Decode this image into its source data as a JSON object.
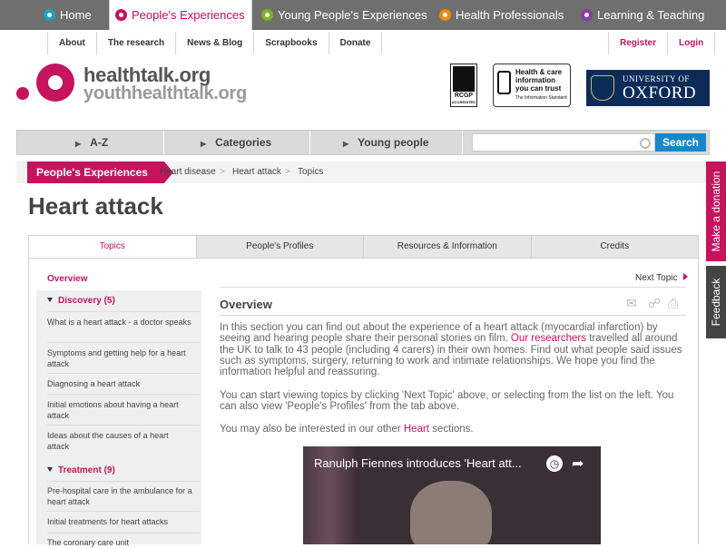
{
  "topnav": {
    "tabs": [
      {
        "label": "Home",
        "color": "#1aa3c4"
      },
      {
        "label": "People's Experiences",
        "color": "#c4145e"
      },
      {
        "label": "Young People's Experiences",
        "color": "#7ab51d"
      },
      {
        "label": "Health Professionals",
        "color": "#f08a00"
      },
      {
        "label": "Learning & Teaching",
        "color": "#8b3fa0"
      }
    ]
  },
  "subnav": {
    "left": [
      "About",
      "The research",
      "News & Blog",
      "Scrapbooks",
      "Donate"
    ],
    "right": [
      "Register",
      "Login"
    ]
  },
  "logo": {
    "line1": "healthtalk.org",
    "line2": "youthhealthtalk.org"
  },
  "badges": {
    "rcgp": "RCGP",
    "rcgp_sub": "ACCREDITED",
    "infostd": "Health & care information you can trust",
    "infostd_sub": "The Information Standard",
    "oxford_l1": "UNIVERSITY OF",
    "oxford_l2": "OXFORD"
  },
  "searchbar": {
    "items": [
      "A-Z",
      "Categories",
      "Young people"
    ],
    "search_button": "Search",
    "placeholder": ""
  },
  "breadcrumb": {
    "active": "People's Experiences",
    "items": [
      "Heart disease",
      "Heart attack",
      "Topics"
    ]
  },
  "page_title": "Heart attack",
  "side_tabs": {
    "donate": "Make a donation",
    "feedback": "Feedback"
  },
  "content_tabs": [
    "Topics",
    "People's Profiles",
    "Resources & Information",
    "Credits"
  ],
  "sidebar": {
    "overview": "Overview",
    "section1": "Discovery (5)",
    "section1_items": [
      "What is a heart attack - a doctor speaks",
      "Symptoms and getting help for a heart attack",
      "Diagnosing a heart attack",
      "Initial emotions about having a heart attack",
      "Ideas about the causes of a heart attack"
    ],
    "section2": "Treatment (9)",
    "section2_items": [
      "Pre-hospital care in the ambulance for a heart attack",
      "Initial treatments for heart attacks",
      "The coronary care unit"
    ]
  },
  "main": {
    "next_topic": "Next Topic",
    "heading": "Overview",
    "p1_a": "In this section you can find out about the experience of a heart attack (myocardial infarction) by seeing and hearing people share their personal stories on film. ",
    "p1_link": "Our researchers",
    "p1_b": " travelled all around the UK to talk to 43 people (including 4 carers) in their own homes. Find out what people said issues such as symptoms, surgery, returning to work and intimate relationships. We hope you find the information helpful and reassuring.",
    "p2": "You can start viewing topics by clicking 'Next Topic' above, or selecting from the list on the left. You can also view 'People's Profiles' from the tab above.",
    "p3_a": "You may also be interested in our other ",
    "p3_link": "Heart",
    "p3_b": " sections.",
    "video_title": "Ranulph Fiennes introduces 'Heart att..."
  }
}
